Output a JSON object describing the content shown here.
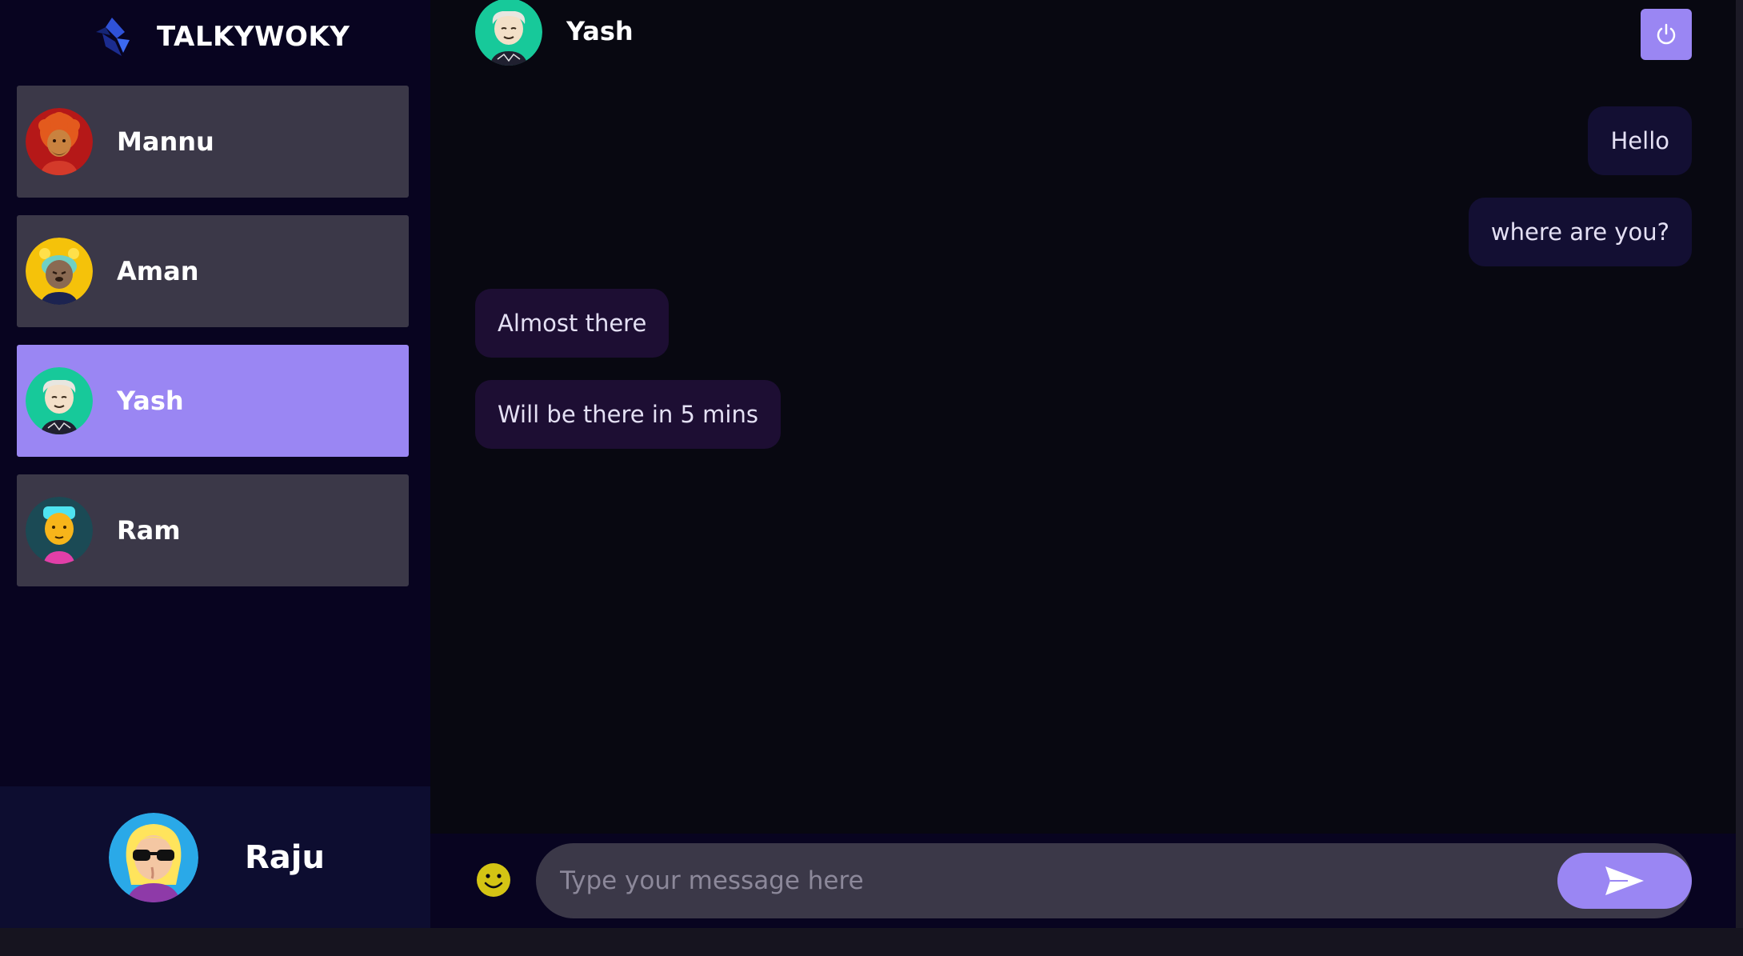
{
  "brand": {
    "name": "TALKYWOKY",
    "logo_icon": "diamond-logo-icon"
  },
  "contacts": [
    {
      "name": "Mannu",
      "avatar": "avatar-red-beard",
      "selected": false
    },
    {
      "name": "Aman",
      "avatar": "avatar-yellow-bear",
      "selected": false
    },
    {
      "name": "Yash",
      "avatar": "avatar-teal-elder",
      "selected": true
    },
    {
      "name": "Ram",
      "avatar": "avatar-cyan-hair",
      "selected": false
    }
  ],
  "current_user": {
    "name": "Raju",
    "avatar": "avatar-blonde-sunglasses"
  },
  "chat": {
    "header_name": "Yash",
    "logout_icon": "power-icon",
    "messages": [
      {
        "text": "Hello",
        "direction": "sent"
      },
      {
        "text": "where are you?",
        "direction": "sent"
      },
      {
        "text": "Almost there",
        "direction": "received"
      },
      {
        "text": "Will be there in 5 mins",
        "direction": "received"
      }
    ],
    "input": {
      "value": "",
      "placeholder": "Type your message here"
    },
    "emoji_icon": "smiley-icon",
    "send_icon": "send-arrow-icon"
  },
  "colors": {
    "accent": "#9a86f3",
    "sidebar_bg": "#080420",
    "chat_bg": "#080811",
    "contact_bg": "#3b3848",
    "emoji": "#d4c414"
  }
}
